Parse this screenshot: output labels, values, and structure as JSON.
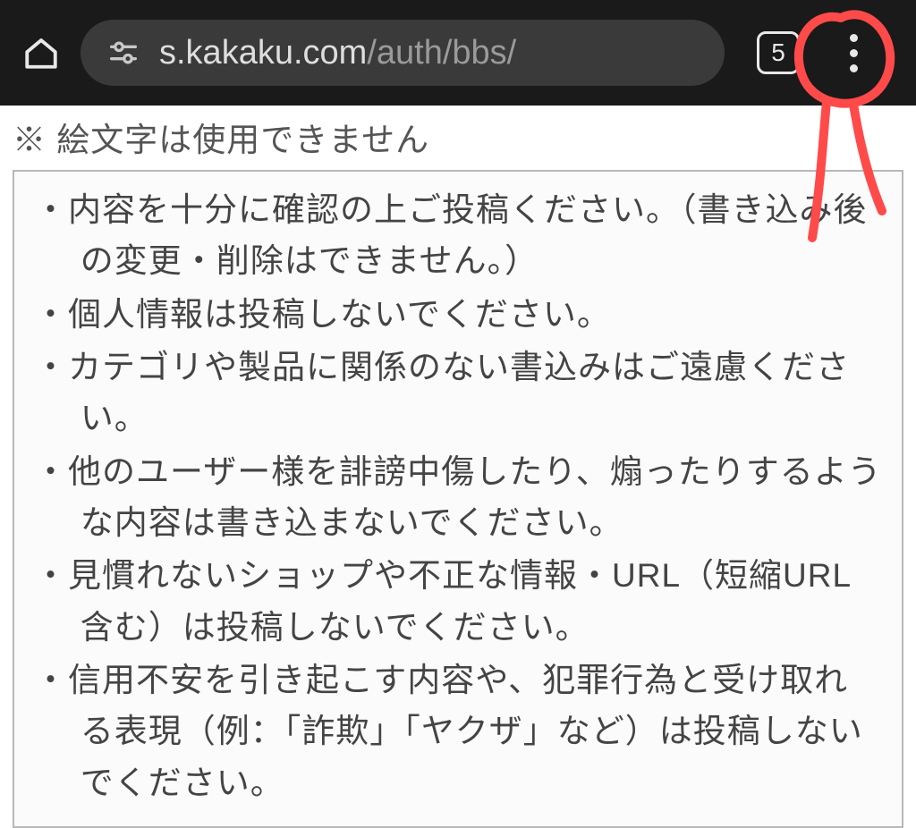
{
  "browser": {
    "url_host": "s.kakaku.com",
    "url_path": "/auth/bbs/",
    "tab_count": "5"
  },
  "content": {
    "emoji_note": "※ 絵文字は使用できません",
    "rules": [
      "・内容を十分に確認の上ご投稿ください。（書き込み後の変更・削除はできません。）",
      "・個人情報は投稿しないでください。",
      "・カテゴリや製品に関係のない書込みはご遠慮ください。",
      "・他のユーザー様を誹謗中傷したり、煽ったりするような内容は書き込まないでください。",
      "・見慣れないショップや不正な情報・URL（短縮URL含む）は投稿しないでください。",
      "・信用不安を引き起こす内容や、犯罪行為と受け取れる表現（例：「詐欺」「ヤクザ」など）は投稿しないでください。"
    ]
  },
  "annotation": {
    "color": "#ff4a4a"
  }
}
